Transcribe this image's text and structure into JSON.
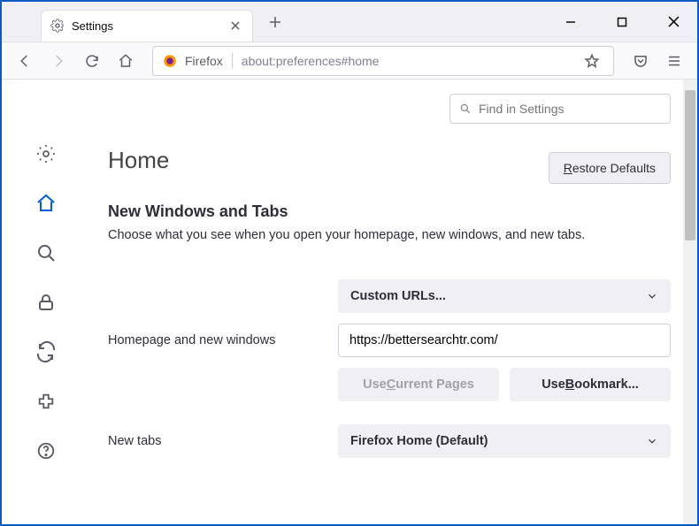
{
  "titlebar": {
    "tab_label": "Settings"
  },
  "toolbar": {
    "identity_label": "Firefox",
    "url": "about:preferences#home"
  },
  "search": {
    "placeholder": "Find in Settings"
  },
  "page": {
    "title": "Home",
    "restore_defaults_pre": "R",
    "restore_defaults_rest": "estore Defaults"
  },
  "section": {
    "title": "New Windows and Tabs",
    "desc": "Choose what you see when you open your homepage, new windows, and new tabs."
  },
  "homepage": {
    "label": "Homepage and new windows",
    "select_value": "Custom URLs...",
    "url_value": "https://bettersearchtr.com/",
    "use_current_pre": "Use ",
    "use_current_ul": "C",
    "use_current_post": "urrent Pages",
    "use_bookmark_pre": "Use ",
    "use_bookmark_ul": "B",
    "use_bookmark_post": "ookmark..."
  },
  "newtabs": {
    "label": "New tabs",
    "select_value": "Firefox Home (Default)"
  }
}
